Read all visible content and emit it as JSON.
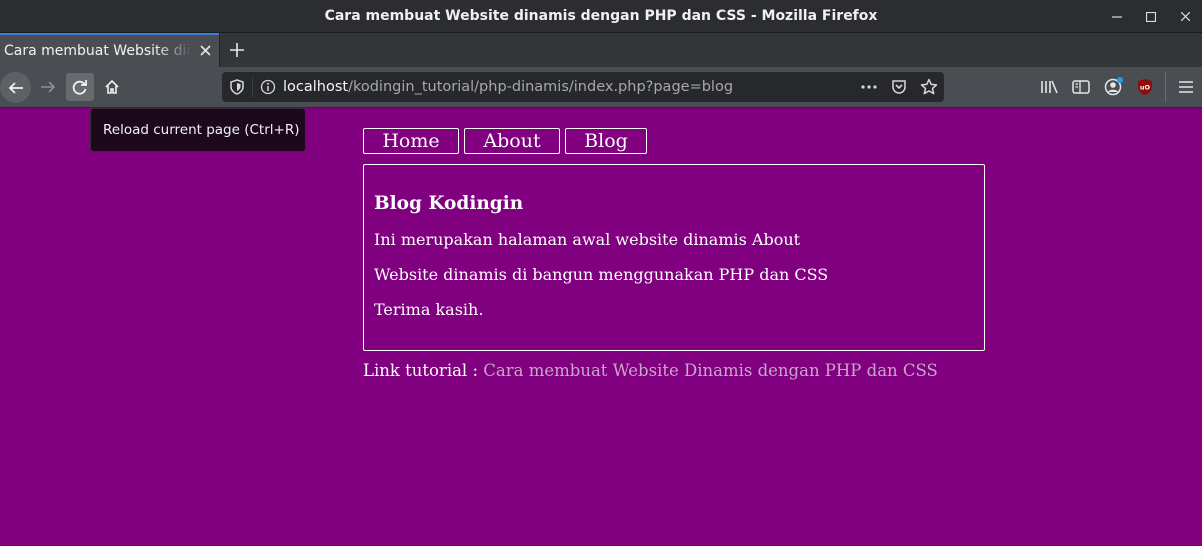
{
  "window": {
    "title": "Cara membuat Website dinamis dengan PHP dan CSS - Mozilla Firefox",
    "controls": {
      "minimize": "—",
      "maximize": "☐",
      "close": "✕"
    }
  },
  "tabs": [
    {
      "label": "Cara membuat Website dinamis dengan PHP dan CSS",
      "active": true,
      "close_icon": "✕"
    }
  ],
  "new_tab_label": "+",
  "navbar": {
    "back_icon": "←",
    "forward_icon": "→",
    "reload_icon": "↻",
    "home_icon": "⌂",
    "url": {
      "host": "localhost",
      "path": "/kodingin_tutorial/php-dinamis/index.php?page=blog"
    },
    "url_actions": {
      "more": "•••",
      "pocket": "pocket",
      "bookmark": "☆"
    },
    "toolbar_icons": [
      "library",
      "sidebar",
      "account",
      "ublock",
      "menu"
    ],
    "accent_badge_color": "#1ba1f0"
  },
  "tooltip": {
    "text": "Reload current page (Ctrl+R)"
  },
  "page": {
    "background": "#800080",
    "menu": [
      {
        "label": "Home"
      },
      {
        "label": "About"
      },
      {
        "label": "Blog"
      }
    ],
    "content": {
      "heading": "Blog Kodingin",
      "paragraphs": [
        "Ini merupakan halaman awal website dinamis About",
        "Website dinamis di bangun menggunakan PHP dan CSS",
        "Terima kasih."
      ]
    },
    "footer": {
      "prefix": "Link tutorial : ",
      "link_text": "Cara membuat Website Dinamis dengan PHP dan CSS"
    }
  }
}
